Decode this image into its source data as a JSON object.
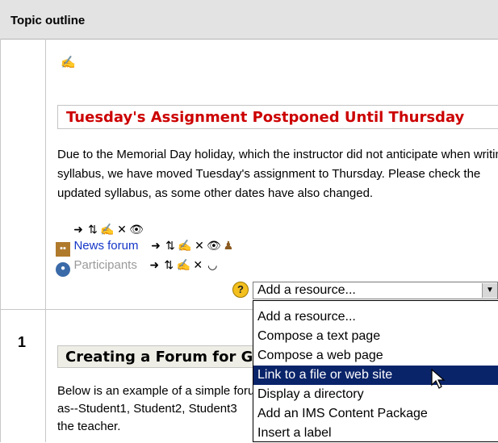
{
  "header": {
    "title": "Topic outline"
  },
  "section0": {
    "assignment_title": "Tuesday's Assignment Postponed Until Thursday",
    "paragraph": [
      "Due to the Memorial Day holiday, which the instructor did not anticipate when writing the",
      "syllabus, we have moved Tuesday's assignment to Thursday. Please check the",
      "updated syllabus, as some other dates have also changed."
    ],
    "news_forum": "News forum",
    "participants": "Participants",
    "help_symbol": "?",
    "add_resource_selected": "Add a resource..."
  },
  "dropdown": {
    "options": [
      "Add a resource...",
      "Compose a text page",
      "Compose a web page",
      "Link to a file or web site",
      "Display a directory",
      "Add an IMS Content Package",
      "Insert a label"
    ],
    "highlighted_index": 3
  },
  "section1": {
    "number": "1",
    "forum_title": "Creating a Forum for Group Work",
    "paragraph": [
      "Below is an example of a simple forum, with",
      "as--Student1, Student2, Student3",
      "the teacher."
    ]
  },
  "colors": {
    "link": "#1436c8",
    "assignment": "#cc0000",
    "highlight": "#0a246a"
  }
}
